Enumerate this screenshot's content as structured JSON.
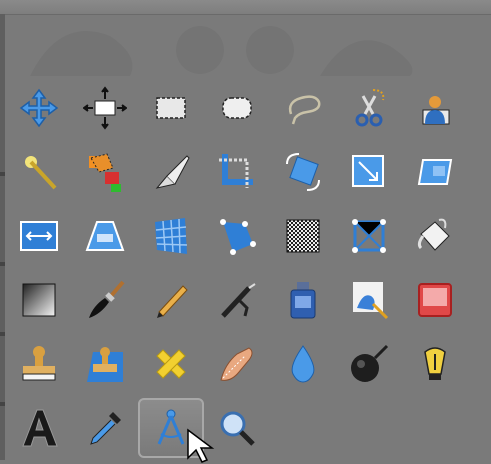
{
  "toolbox": {
    "active_tool": "measure-tool",
    "tools": [
      "move-tool",
      "alignment-tool",
      "rect-select-tool",
      "ellipse-select-tool",
      "free-select-tool",
      "scissors-select-tool",
      "foreground-select-tool",
      "fuzzy-select-tool",
      "select-by-color-tool",
      "paths-tool",
      "color-picker-tool",
      "rotate-tool",
      "scale-tool",
      "shear-tool",
      "flip-tool",
      "perspective-tool",
      "cage-transform-tool",
      "unified-transform-tool",
      "noise-tool",
      "warp-tool",
      "bucket-fill-tool",
      "blend-tool",
      "paintbrush-tool",
      "pencil-tool",
      "airbrush-tool",
      "ink-tool",
      "mypaint-brush-tool",
      "eraser-tool",
      "clone-tool",
      "perspective-clone-tool",
      "heal-tool",
      "smudge-tool",
      "blur-sharpen-tool",
      "dodge-burn-tool",
      "bucket-lamp-tool",
      "text-tool",
      "eyedropper-tool",
      "measure-tool",
      "zoom-tool"
    ]
  },
  "colors": {
    "panel_bg": "#7a7a7a",
    "icon_blue": "#2f7fd6",
    "icon_dark": "#1e1e1e"
  }
}
